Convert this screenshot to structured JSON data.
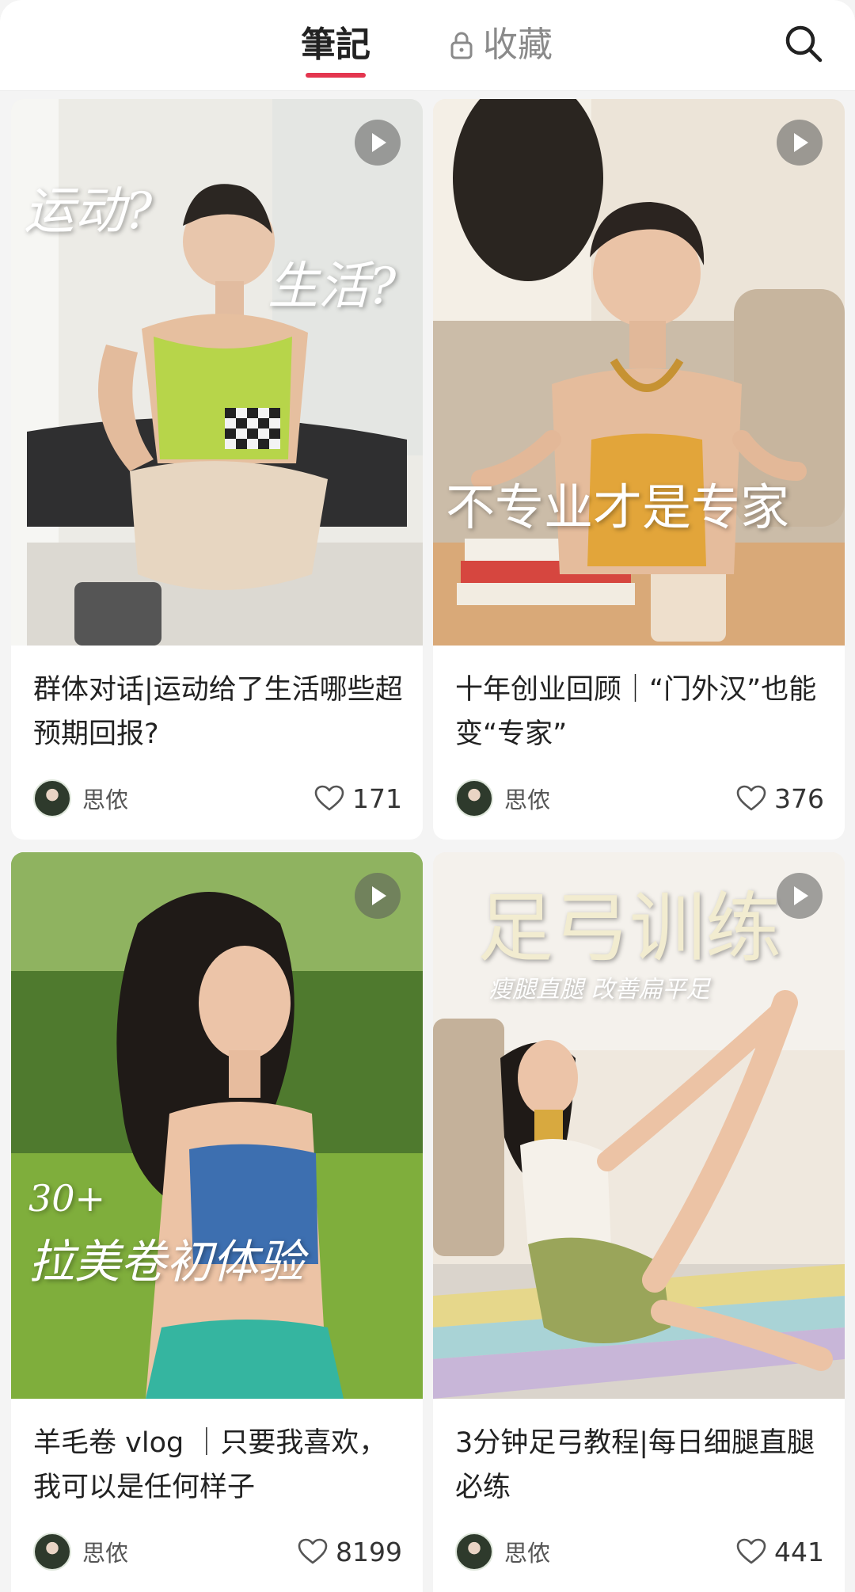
{
  "header": {
    "tabs": [
      {
        "label": "筆記",
        "active": true
      },
      {
        "label": "收藏",
        "active": false,
        "locked": true
      }
    ],
    "search_icon": "search-icon",
    "accent_color": "#e4364f"
  },
  "notes": [
    {
      "title": "群体对话|运动给了生活哪些超预期回报?",
      "overlay_lines": [
        "运动?",
        "生活?"
      ],
      "author": "思侬",
      "likes": "171",
      "is_video": true
    },
    {
      "title": "十年创业回顾｜“门外汉”也能变“专家”",
      "overlay_lines": [
        "不专业才是专家"
      ],
      "author": "思侬",
      "likes": "376",
      "is_video": true
    },
    {
      "title": "羊毛卷 vlog ｜只要我喜欢，我可以是任何样子",
      "overlay_lines": [
        "30+",
        "拉美卷初体验"
      ],
      "author": "思侬",
      "likes": "8199",
      "is_video": true
    },
    {
      "title": "3分钟足弓教程|每日细腿直腿必练",
      "overlay_lines": [
        "足弓训练",
        "瘦腿直腿 改善扁平足"
      ],
      "author": "思侬",
      "likes": "441",
      "is_video": true
    }
  ]
}
